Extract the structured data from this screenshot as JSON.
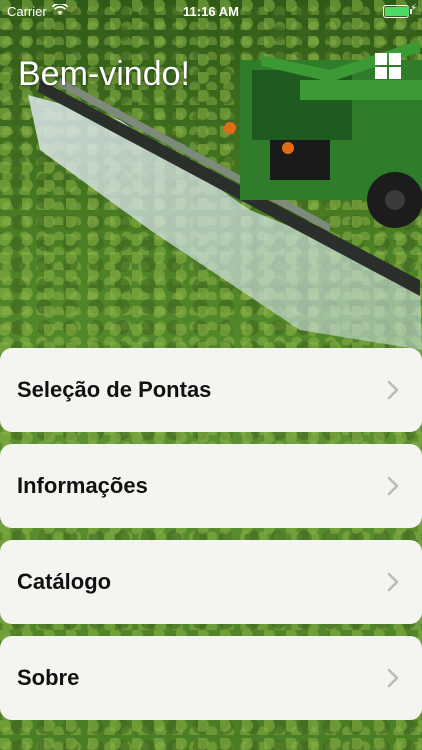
{
  "status_bar": {
    "carrier": "Carrier",
    "time": "11:16 AM",
    "battery_color": "#4cd964"
  },
  "header": {
    "title": "Bem-vindo!",
    "grid_icon": "grid-icon"
  },
  "menu": [
    {
      "label": "Seleção de Pontas"
    },
    {
      "label": "Informações"
    },
    {
      "label": "Catálogo"
    },
    {
      "label": "Sobre"
    }
  ]
}
